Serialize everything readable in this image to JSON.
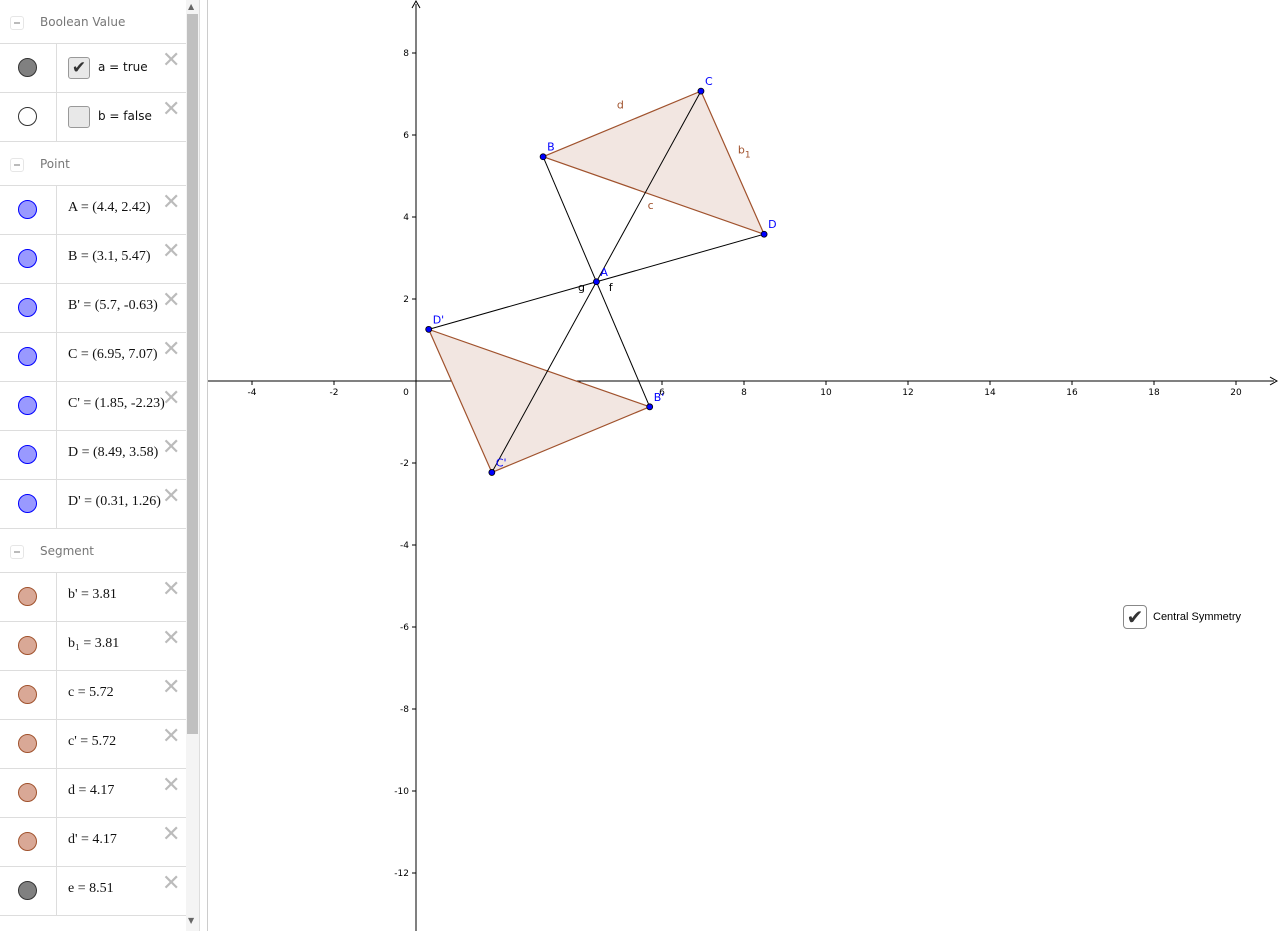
{
  "algebra": {
    "groups": [
      {
        "title": "Boolean Value",
        "items": [
          {
            "kind": "bool",
            "checked": true,
            "label": "a = true",
            "color": "#808080"
          },
          {
            "kind": "bool",
            "checked": false,
            "label": "b = false",
            "color": "#ffffff"
          }
        ]
      },
      {
        "title": "Point",
        "items": [
          {
            "label": "A = (4.4, 2.42)",
            "color": "#9999ff"
          },
          {
            "label": "B = (3.1, 5.47)",
            "color": "#9999ff"
          },
          {
            "label": "B' = (5.7, -0.63)",
            "color": "#9999ff"
          },
          {
            "label": "C = (6.95, 7.07)",
            "color": "#9999ff"
          },
          {
            "label": "C' = (1.85, -2.23)",
            "color": "#9999ff"
          },
          {
            "label": "D = (8.49, 3.58)",
            "color": "#9999ff"
          },
          {
            "label": "D' = (0.31, 1.26)",
            "color": "#9999ff"
          }
        ]
      },
      {
        "title": "Segment",
        "items": [
          {
            "label": "b' = 3.81",
            "color": "#d9a896"
          },
          {
            "label": "b₁ = 3.81",
            "color": "#d9a896"
          },
          {
            "label": "c = 5.72",
            "color": "#d9a896"
          },
          {
            "label": "c' = 5.72",
            "color": "#d9a896"
          },
          {
            "label": "d = 4.17",
            "color": "#d9a896"
          },
          {
            "label": "d' = 4.17",
            "color": "#d9a896"
          },
          {
            "label": "e = 8.51",
            "color": "#808080"
          }
        ]
      }
    ],
    "delete_icon": "close-icon"
  },
  "graphics": {
    "x_ticks": [
      -4,
      -2,
      0,
      2,
      4,
      6,
      8,
      10,
      12,
      14,
      16,
      18,
      20
    ],
    "y_ticks": [
      8,
      6,
      4,
      2,
      -2,
      -4,
      -6,
      -8,
      -10,
      -12
    ],
    "points": {
      "A": [
        4.4,
        2.42
      ],
      "B": [
        3.1,
        5.47
      ],
      "B'": [
        5.7,
        -0.63
      ],
      "C": [
        6.95,
        7.07
      ],
      "C'": [
        1.85,
        -2.23
      ],
      "D": [
        8.49,
        3.58
      ],
      "D'": [
        0.31,
        1.26
      ]
    },
    "polygons": [
      [
        "B",
        "C",
        "D"
      ],
      [
        "B'",
        "C'",
        "D'"
      ]
    ],
    "lines": [
      [
        "B",
        "B'"
      ],
      [
        "C",
        "C'"
      ],
      [
        "D",
        "D'"
      ]
    ],
    "segment_labels": [
      {
        "text": "d",
        "at": [
          4.9,
          6.65
        ]
      },
      {
        "text": "b",
        "sub": "1",
        "at": [
          7.85,
          5.55
        ]
      },
      {
        "text": "c",
        "at": [
          5.65,
          4.2
        ]
      },
      {
        "text": "g",
        "at": [
          3.95,
          2.2
        ]
      },
      {
        "text": "f",
        "at": [
          4.7,
          2.2
        ]
      }
    ],
    "colors": {
      "point": "#0000ff",
      "segment": "#a0522d",
      "fill": "#f2e6e1",
      "line": "#000000"
    },
    "checkbox": {
      "label": "Central Symmetry",
      "checked": true
    }
  }
}
